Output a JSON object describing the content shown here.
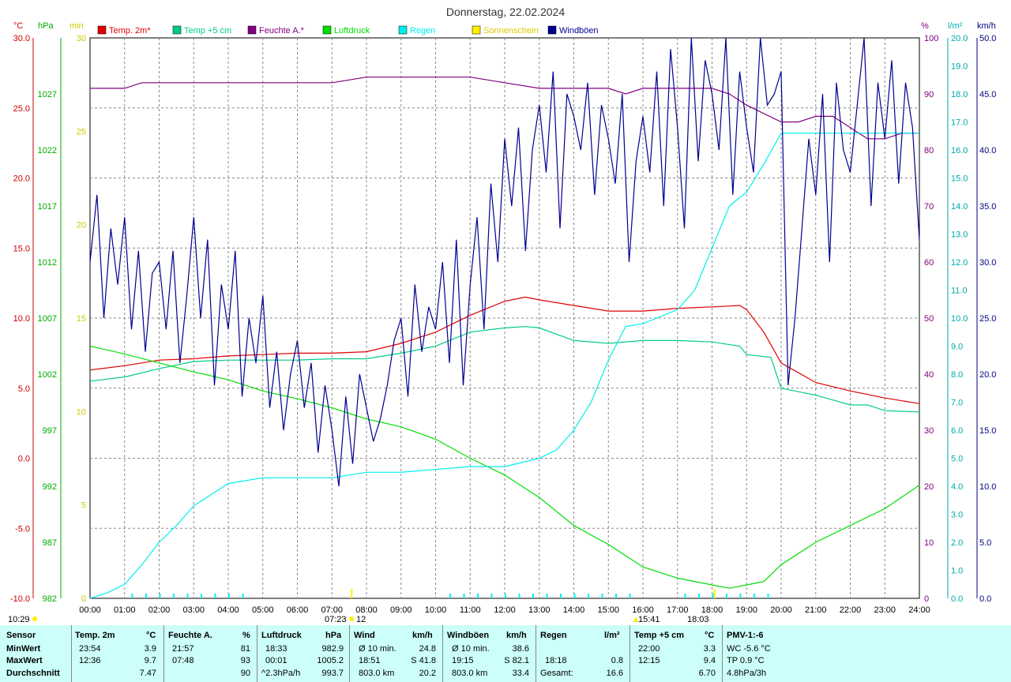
{
  "title": "Donnerstag, 22.02.2024",
  "axes": {
    "temp": {
      "unit": "°C",
      "color": "#cc0000",
      "ticks": [
        "30.0",
        "25.0",
        "20.0",
        "15.0",
        "10.0",
        "5.0",
        "0.0",
        "-5.0",
        "-10.0"
      ]
    },
    "pressure": {
      "unit": "hPa",
      "color": "#00aa00",
      "ticks": [
        "1027",
        "1022",
        "1017",
        "1012",
        "1007",
        "1002",
        "997",
        "992",
        "987",
        "982"
      ]
    },
    "sun": {
      "unit": "min",
      "color": "#cccc00",
      "ticks": [
        "30",
        "25",
        "20",
        "15",
        "10",
        "5",
        "0"
      ]
    },
    "humidity": {
      "unit": "%",
      "color": "#800080",
      "ticks": [
        "100",
        "90",
        "80",
        "70",
        "60",
        "50",
        "40",
        "30",
        "20",
        "10",
        "0"
      ]
    },
    "rain": {
      "unit": "l/m²",
      "color": "#00aaaa",
      "ticks": [
        "20.0",
        "19.0",
        "18.0",
        "17.0",
        "16.0",
        "15.0",
        "14.0",
        "13.0",
        "12.0",
        "11.0",
        "10.0",
        "9.0",
        "8.0",
        "7.0",
        "6.0",
        "5.0",
        "4.0",
        "3.0",
        "2.0",
        "1.0",
        "0.0"
      ]
    },
    "wind": {
      "unit": "km/h",
      "color": "#000080",
      "ticks": [
        "50.0",
        "45.0",
        "40.0",
        "35.0",
        "30.0",
        "25.0",
        "20.0",
        "15.0",
        "10.0",
        "5.0",
        "0.0"
      ]
    }
  },
  "legend": [
    {
      "label": "Temp. 2m*",
      "color": "#e00000"
    },
    {
      "label": "Temp +5 cm",
      "color": "#00cc88"
    },
    {
      "label": "Feuchte A.*",
      "color": "#800080"
    },
    {
      "label": "Luftdruck",
      "color": "#00dd00"
    },
    {
      "label": "Regen",
      "color": "#00eeee"
    },
    {
      "label": "Sonnenschein",
      "color": "#ffee00"
    },
    {
      "label": "Windböen",
      "color": "#000090"
    }
  ],
  "x_ticks": [
    "00:00",
    "01:00",
    "02:00",
    "03:00",
    "04:00",
    "05:00",
    "06:00",
    "07:00",
    "08:00",
    "09:00",
    "10:00",
    "11:00",
    "12:00",
    "13:00",
    "14:00",
    "15:00",
    "16:00",
    "17:00",
    "18:00",
    "19:00",
    "20:00",
    "21:00",
    "22:00",
    "23:00",
    "24:00"
  ],
  "markers": {
    "sunrise": "07:23",
    "sunrise_extra": "12",
    "time_1029": "10:29",
    "time_1541": "15:41",
    "time_1803": "18:03"
  },
  "chart_data": {
    "type": "line",
    "x_unit": "hour",
    "xlim": [
      0,
      24
    ],
    "series": [
      {
        "name": "Temp. 2m*",
        "color": "#e00000",
        "axis": "temp",
        "ylim": [
          -10,
          30
        ],
        "x": [
          0,
          1,
          2,
          3,
          4,
          5,
          6,
          7,
          8,
          9,
          10,
          11,
          12,
          12.6,
          13,
          14,
          15,
          16,
          17,
          18,
          18.8,
          19,
          19.5,
          20,
          21,
          22,
          23,
          24
        ],
        "y": [
          6.3,
          6.6,
          7.0,
          7.1,
          7.3,
          7.4,
          7.5,
          7.5,
          7.6,
          8.2,
          9.0,
          10.2,
          11.2,
          11.5,
          11.3,
          10.9,
          10.5,
          10.5,
          10.7,
          10.8,
          10.9,
          10.6,
          9.0,
          6.8,
          5.4,
          4.8,
          4.3,
          3.9
        ]
      },
      {
        "name": "Temp +5 cm",
        "color": "#00cc88",
        "axis": "temp",
        "ylim": [
          -10,
          30
        ],
        "x": [
          0,
          1,
          2,
          3,
          4,
          5,
          6,
          7,
          8,
          9,
          10,
          10.5,
          11,
          12,
          12.6,
          13,
          14,
          15,
          16,
          17,
          18,
          18.8,
          19,
          19.7,
          20,
          21,
          22,
          22.5,
          23,
          24
        ],
        "y": [
          5.5,
          5.8,
          6.4,
          6.9,
          7.0,
          7.0,
          7.0,
          7.1,
          7.1,
          7.5,
          8.0,
          8.5,
          9.0,
          9.3,
          9.4,
          9.3,
          8.4,
          8.2,
          8.4,
          8.4,
          8.3,
          8.0,
          7.4,
          7.2,
          5.0,
          4.5,
          3.8,
          3.8,
          3.4,
          3.3
        ]
      },
      {
        "name": "Feuchte A.*",
        "color": "#800080",
        "axis": "humidity",
        "ylim": [
          0,
          100
        ],
        "x": [
          0,
          1,
          1.5,
          7,
          8,
          9,
          10,
          11,
          12,
          13,
          14,
          15,
          15.5,
          16,
          17,
          17.5,
          18,
          18.5,
          19,
          20,
          20.5,
          21,
          21.5,
          22,
          22.5,
          23,
          23.5,
          24
        ],
        "y": [
          91,
          91,
          92,
          92,
          93,
          93,
          93,
          93,
          92,
          91,
          91,
          91,
          90,
          91,
          91,
          91,
          91,
          90,
          88,
          85,
          85,
          86,
          86,
          84,
          82,
          82,
          83,
          83
        ]
      },
      {
        "name": "Luftdruck",
        "color": "#00dd00",
        "axis": "pressure",
        "ylim": [
          982,
          1032
        ],
        "x": [
          0,
          1,
          2,
          3,
          4,
          5,
          6,
          7,
          8,
          9,
          10,
          11,
          12,
          13,
          14,
          15,
          16,
          17,
          18,
          18.5,
          19,
          19.5,
          20,
          21,
          22,
          23,
          24
        ],
        "y": [
          1004.5,
          1003.8,
          1003.0,
          1002.2,
          1001.5,
          1000.5,
          999.8,
          999.0,
          998.0,
          997.3,
          996.2,
          994.5,
          993.0,
          991.0,
          988.5,
          986.8,
          984.8,
          983.8,
          983.2,
          982.9,
          983.2,
          983.5,
          985.0,
          987.0,
          988.5,
          990.0,
          992.1
        ]
      },
      {
        "name": "Regen",
        "color": "#00eeee",
        "axis": "rain",
        "ylim": [
          0,
          20
        ],
        "x": [
          0,
          0.5,
          1,
          1.5,
          2,
          2.5,
          3,
          3.5,
          4,
          5,
          6,
          7,
          8,
          9,
          10,
          11,
          12,
          13,
          13.5,
          14,
          14.5,
          15,
          15.5,
          16,
          17,
          17.5,
          18,
          18.5,
          19,
          19.5,
          20,
          21,
          22,
          23,
          24
        ],
        "y": [
          0,
          0.2,
          0.5,
          1.2,
          2.0,
          2.6,
          3.3,
          3.7,
          4.1,
          4.3,
          4.3,
          4.3,
          4.5,
          4.5,
          4.6,
          4.7,
          4.7,
          5.0,
          5.3,
          6.0,
          7.0,
          8.5,
          9.7,
          9.8,
          10.3,
          11.0,
          12.5,
          14.0,
          14.5,
          15.5,
          16.6,
          16.6,
          16.6,
          16.6,
          16.6
        ]
      },
      {
        "name": "Windböen",
        "color": "#000090",
        "axis": "wind",
        "ylim": [
          0,
          50
        ],
        "x": [
          0,
          0.2,
          0.4,
          0.6,
          0.8,
          1,
          1.2,
          1.4,
          1.6,
          1.8,
          2,
          2.2,
          2.4,
          2.6,
          2.8,
          3,
          3.2,
          3.4,
          3.6,
          3.8,
          4,
          4.2,
          4.4,
          4.6,
          4.8,
          5,
          5.2,
          5.4,
          5.6,
          5.8,
          6,
          6.2,
          6.4,
          6.6,
          6.8,
          7,
          7.2,
          7.4,
          7.6,
          7.8,
          8,
          8.2,
          8.4,
          8.6,
          8.8,
          9,
          9.2,
          9.4,
          9.6,
          9.8,
          10,
          10.2,
          10.4,
          10.6,
          10.8,
          11,
          11.2,
          11.4,
          11.6,
          11.8,
          12,
          12.2,
          12.4,
          12.6,
          12.8,
          13,
          13.2,
          13.4,
          13.6,
          13.8,
          14,
          14.2,
          14.4,
          14.6,
          14.8,
          15,
          15.2,
          15.4,
          15.6,
          15.8,
          16,
          16.2,
          16.4,
          16.6,
          16.8,
          17,
          17.2,
          17.4,
          17.6,
          17.8,
          18,
          18.2,
          18.4,
          18.6,
          18.8,
          19,
          19.2,
          19.4,
          19.6,
          19.8,
          20,
          20.2,
          20.4,
          20.6,
          20.8,
          21,
          21.2,
          21.4,
          21.6,
          21.8,
          22,
          22.2,
          22.4,
          22.6,
          22.8,
          23,
          23.2,
          23.4,
          23.6,
          23.8,
          24
        ],
        "y": [
          30,
          36,
          25,
          33,
          28,
          34,
          24,
          31,
          22,
          29,
          30,
          24,
          31,
          21,
          27,
          34,
          25,
          32,
          19,
          28,
          24,
          31,
          18,
          25,
          21,
          27,
          17,
          22,
          15,
          20,
          23,
          17,
          21,
          13,
          19,
          15,
          10,
          18,
          12,
          20,
          17,
          14,
          16,
          19,
          23,
          25,
          18,
          28,
          22,
          26,
          24,
          30,
          21,
          32,
          19,
          28,
          34,
          24,
          37,
          30,
          41,
          35,
          42,
          31,
          40,
          44,
          38,
          47,
          33,
          45,
          43,
          40,
          46,
          36,
          44,
          41,
          37,
          45,
          30,
          39,
          43,
          38,
          47,
          35,
          49,
          42,
          33,
          50,
          39,
          48,
          45,
          40,
          50,
          36,
          47,
          42,
          38,
          50,
          44,
          45,
          47,
          19,
          25,
          33,
          41,
          36,
          45,
          30,
          46,
          40,
          38,
          44,
          50,
          35,
          46,
          41,
          48,
          37,
          46,
          42,
          32
        ]
      }
    ],
    "wind_avg_label": "Ø 10 min."
  },
  "table": {
    "header": {
      "sensor": "Sensor",
      "temp": "Temp. 2m",
      "temp_u": "°C",
      "hum": "Feuchte A.",
      "hum_u": "%",
      "press": "Luftdruck",
      "press_u": "hPa",
      "wind": "Wind",
      "wind_u": "km/h",
      "gust": "Windböen",
      "gust_u": "km/h",
      "rain": "Regen",
      "rain_u": "l/m²",
      "t5": "Temp +5 cm",
      "t5_u": "°C",
      "pmv": "PMV-1:-6"
    },
    "rows": {
      "min": {
        "label": "MinWert",
        "t_time": "23:54",
        "t_val": "3.9",
        "h_time": "21:57",
        "h_val": "81",
        "p_time": "18:33",
        "p_val": "982.9",
        "w_label": "Ø 10 min.",
        "w_val": "24.8",
        "g_label": "Ø 10 min.",
        "g_val": "38.6",
        "r_time": "",
        "r_val": "",
        "t5_time": "22:00",
        "t5_val": "3.3",
        "pmv": "WC -5.6 °C"
      },
      "max": {
        "label": "MaxWert",
        "t_time": "12:36",
        "t_val": "9.7",
        "h_time": "07:48",
        "h_val": "93",
        "p_time": "00:01",
        "p_val": "1005.2",
        "w_label": "18:51",
        "w_val": "S 41.8",
        "g_label": "19:15",
        "g_val": "S 82.1",
        "r_time": "18:18",
        "r_val": "0.8",
        "t5_time": "12:15",
        "t5_val": "9.4",
        "pmv": "TP 0.9 °C"
      },
      "avg": {
        "label": "Durchschnitt",
        "t_time": "",
        "t_val": "7.47",
        "h_time": "",
        "h_val": "90",
        "p_time": "^2.3hPa/h",
        "p_val": "993.7",
        "w_label": "803.0 km",
        "w_val": "20.2",
        "g_label": "803.0 km",
        "g_val": "33.4",
        "r_time": "Gesamt:",
        "r_val": "16.6",
        "t5_time": "",
        "t5_val": "6.70",
        "pmv": "4.8hPa/3h"
      }
    }
  }
}
